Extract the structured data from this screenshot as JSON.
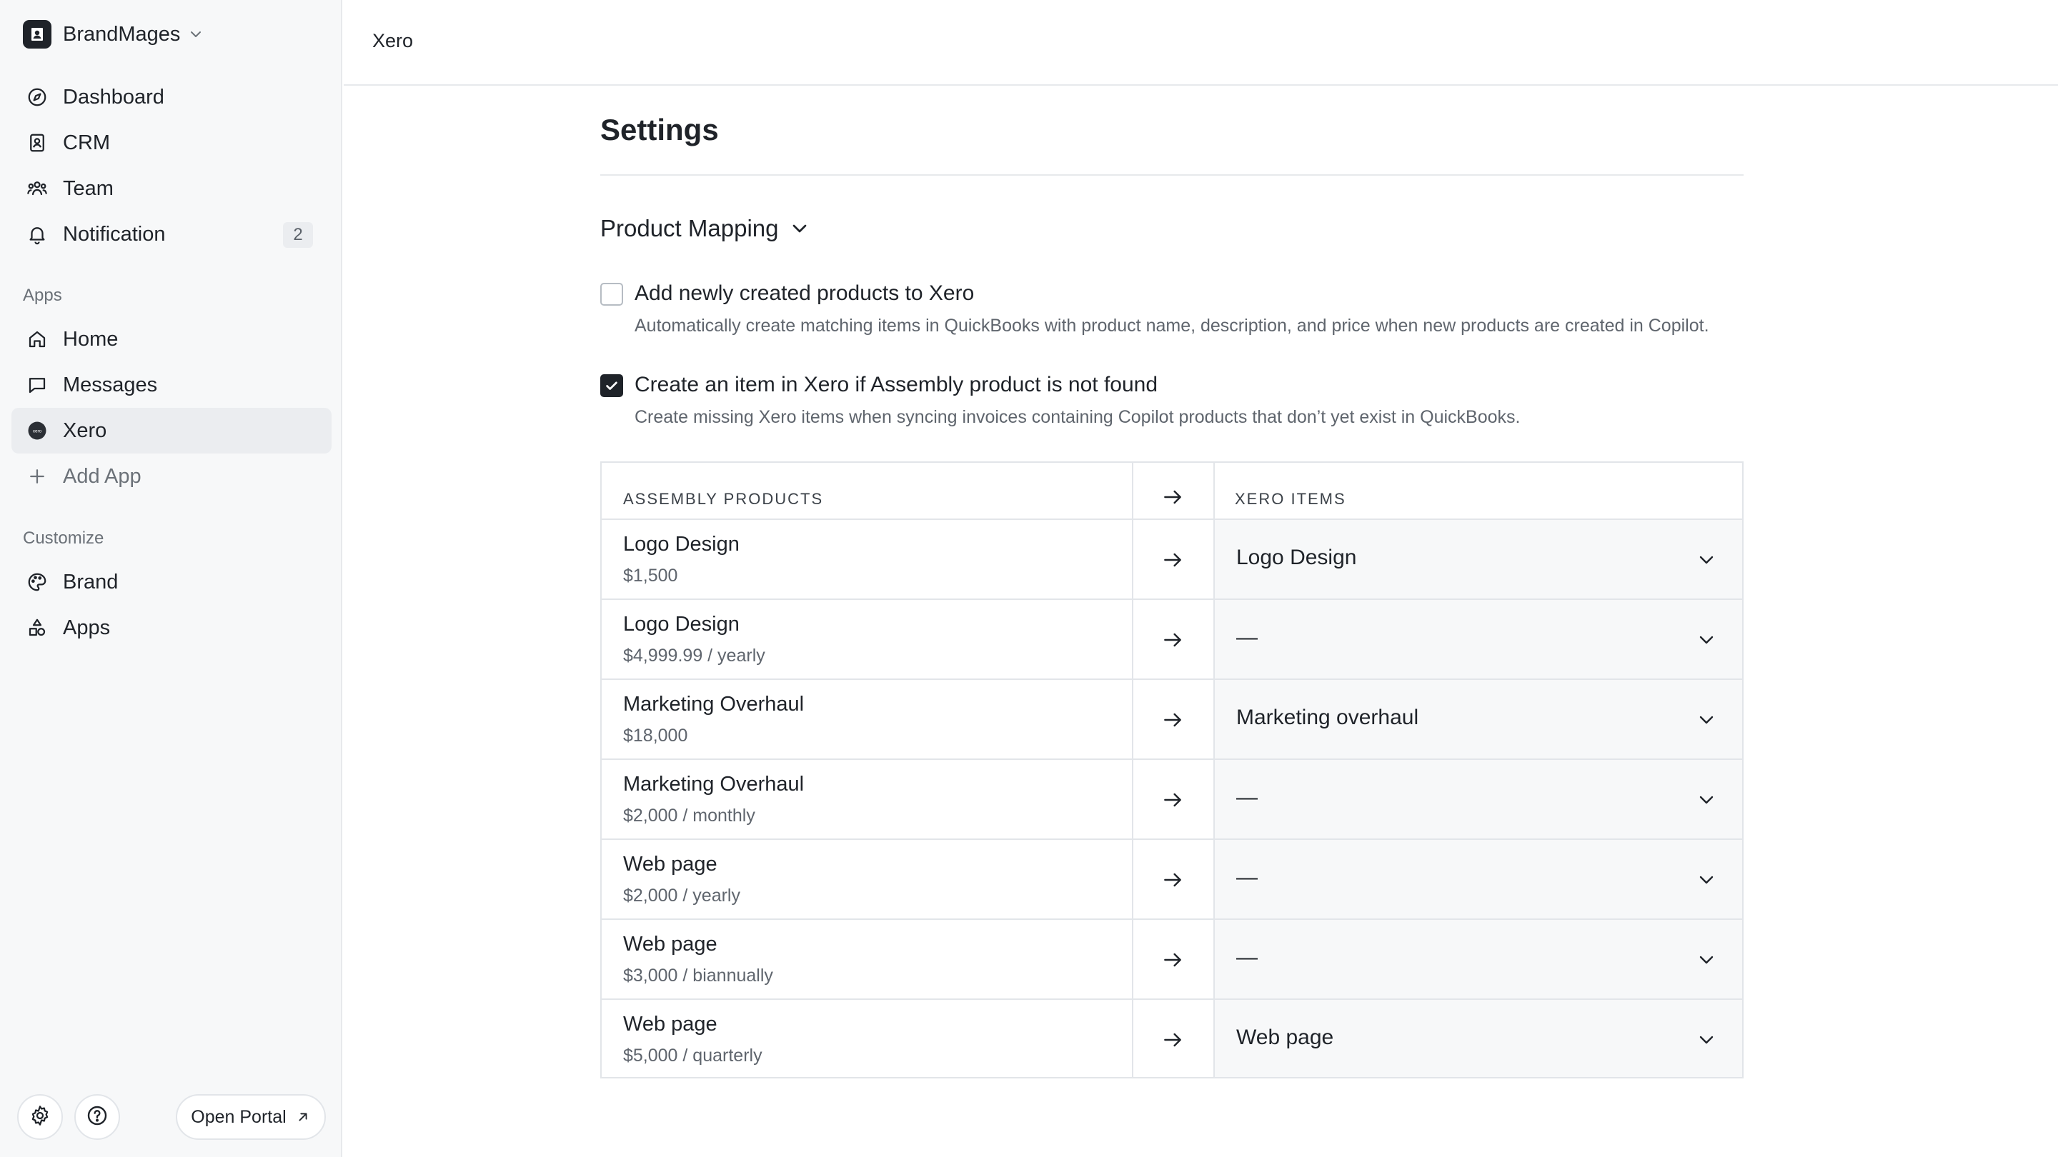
{
  "workspace": {
    "name": "BrandMages"
  },
  "sidebar": {
    "main_items": [
      {
        "label": "Dashboard",
        "icon": "compass-icon"
      },
      {
        "label": "CRM",
        "icon": "contact-book-icon"
      },
      {
        "label": "Team",
        "icon": "team-icon"
      },
      {
        "label": "Notification",
        "icon": "bell-icon",
        "badge": "2"
      }
    ],
    "apps_label": "Apps",
    "apps_items": [
      {
        "label": "Home",
        "icon": "home-icon"
      },
      {
        "label": "Messages",
        "icon": "chat-bubble-icon"
      },
      {
        "label": "Xero",
        "icon": "xero-logo-icon",
        "active": true
      },
      {
        "label": "Add App",
        "icon": "plus-icon"
      }
    ],
    "customize_label": "Customize",
    "customize_items": [
      {
        "label": "Brand",
        "icon": "palette-icon"
      },
      {
        "label": "Apps",
        "icon": "shapes-icon"
      }
    ],
    "footer": {
      "portal_label": "Open Portal"
    }
  },
  "header": {
    "title": "Xero"
  },
  "main": {
    "title": "Settings",
    "section_title": "Product Mapping",
    "options": [
      {
        "label": "Add newly created products to Xero",
        "description": "Automatically create matching items in QuickBooks with product name, description, and price when new products are created in Copilot.",
        "checked": false
      },
      {
        "label": "Create an item in Xero if Assembly product is not found",
        "description": "Create missing Xero items when syncing invoices containing Copilot products that don’t yet exist in QuickBooks.",
        "checked": true
      }
    ],
    "table": {
      "col_left": "ASSEMBLY PRODUCTS",
      "col_right": "XERO ITEMS",
      "rows": [
        {
          "name": "Logo Design",
          "price": "$1,500",
          "mapped": "Logo Design"
        },
        {
          "name": "Logo Design",
          "price": "$4,999.99 / yearly",
          "mapped": "—"
        },
        {
          "name": "Marketing Overhaul",
          "price": "$18,000",
          "mapped": "Marketing overhaul"
        },
        {
          "name": "Marketing Overhaul",
          "price": "$2,000 / monthly",
          "mapped": "—"
        },
        {
          "name": "Web page",
          "price": "$2,000 / yearly",
          "mapped": "—"
        },
        {
          "name": "Web page",
          "price": "$3,000 / biannually",
          "mapped": "—"
        },
        {
          "name": "Web page",
          "price": "$5,000 / quarterly",
          "mapped": "Web page"
        }
      ]
    }
  },
  "colors": {
    "sidebar_bg": "#f7f8f9",
    "active_item_bg": "#ebedf0",
    "text_primary": "#1f2329",
    "text_secondary": "#5f656d",
    "border": "#e2e5e9",
    "checkbox_checked": "#1f2329"
  }
}
